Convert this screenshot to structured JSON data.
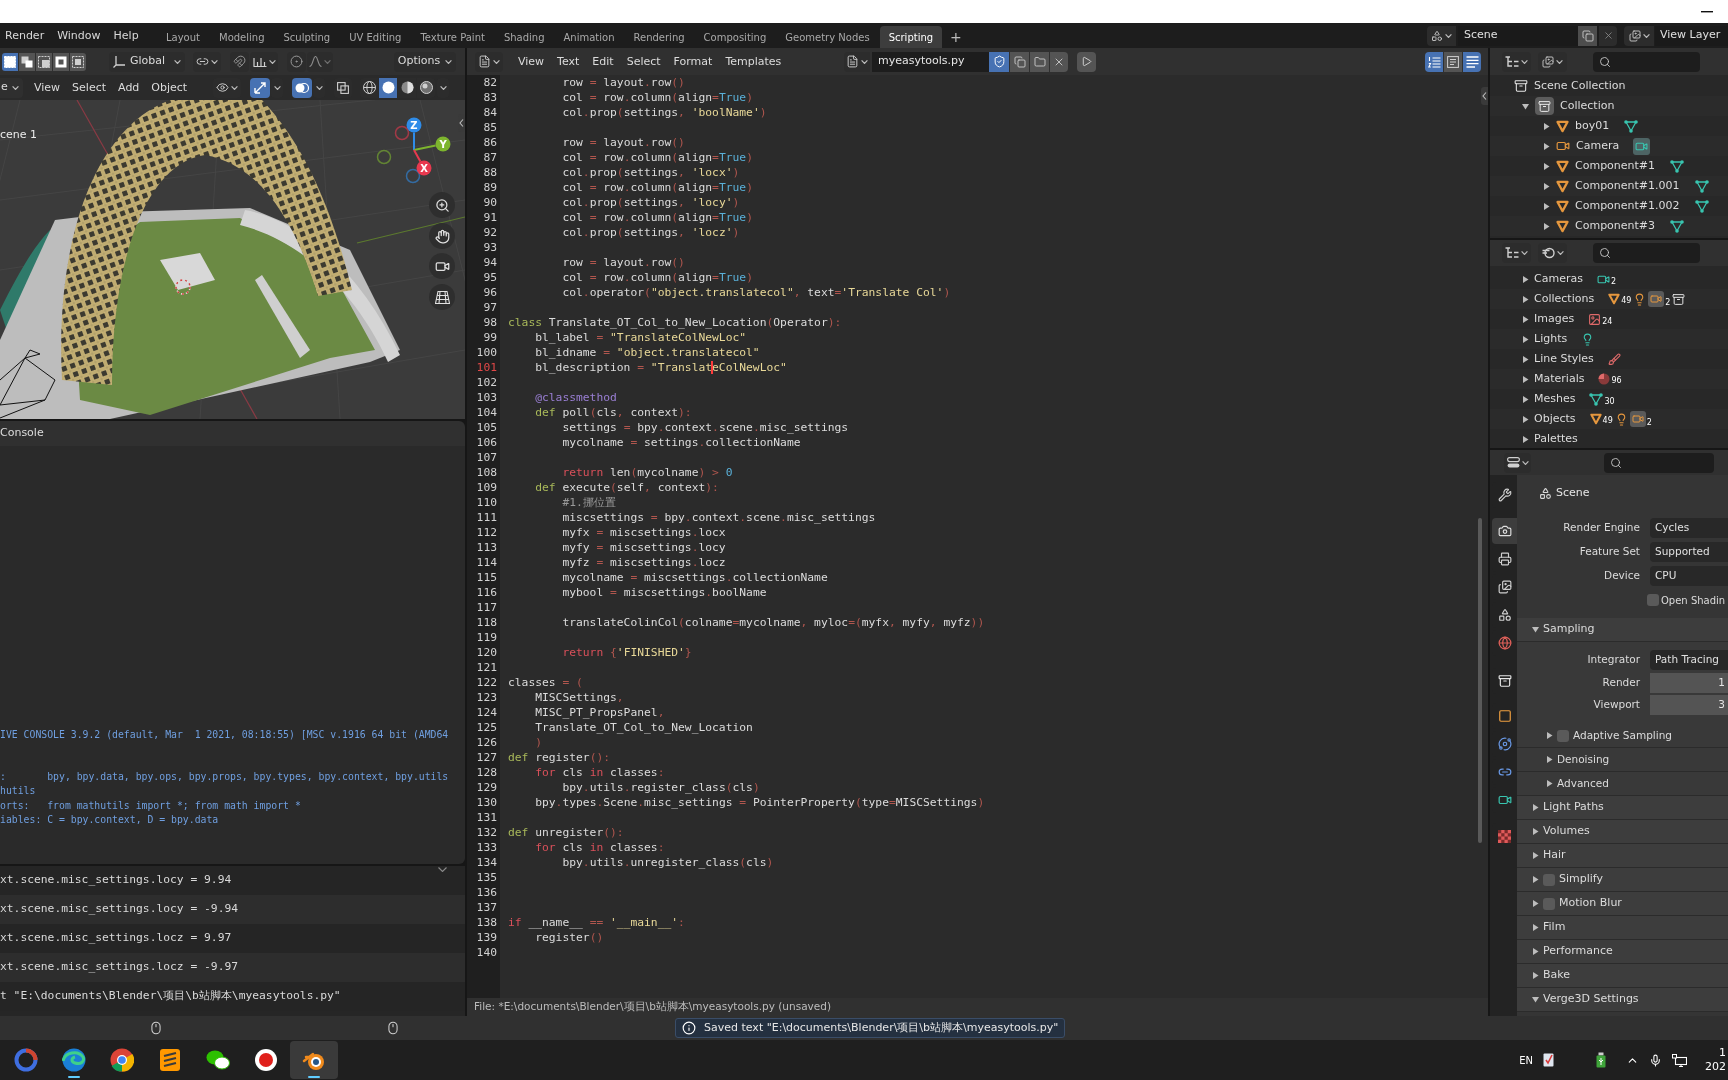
{
  "top_bar": {
    "menus": [
      "Render",
      "Window",
      "Help"
    ],
    "workspaces": [
      {
        "label": "Layout",
        "selected": false
      },
      {
        "label": "Modeling",
        "selected": false
      },
      {
        "label": "Sculpting",
        "selected": false
      },
      {
        "label": "UV Editing",
        "selected": false
      },
      {
        "label": "Texture Paint",
        "selected": false
      },
      {
        "label": "Shading",
        "selected": false
      },
      {
        "label": "Animation",
        "selected": false
      },
      {
        "label": "Rendering",
        "selected": false
      },
      {
        "label": "Compositing",
        "selected": false
      },
      {
        "label": "Geometry Nodes",
        "selected": false
      },
      {
        "label": "Scripting",
        "selected": true
      }
    ],
    "add_workspace": "+",
    "scene": "Scene",
    "view_layer": "View Layer"
  },
  "viewport": {
    "orientation": "Global",
    "options": "Options",
    "select_modes": [
      {
        "selected": true
      },
      {
        "selected": false
      },
      {
        "selected": false
      },
      {
        "selected": false
      },
      {
        "selected": false
      }
    ],
    "mode": "e",
    "menus": [
      "View",
      "Select",
      "Add",
      "Object"
    ],
    "gizmos": true,
    "overlays": true,
    "xray": false,
    "shading_modes": [
      {
        "kind": "wireframe",
        "selected": false
      },
      {
        "kind": "solid",
        "selected": true
      },
      {
        "kind": "material",
        "selected": false
      },
      {
        "kind": "rendered",
        "selected": false
      }
    ],
    "scene_label": "cene 1",
    "axes": [
      {
        "label": "Z",
        "color": "#2f8ce8"
      },
      {
        "label": "Y",
        "color": "#7db52e"
      },
      {
        "label": "X",
        "color": "#e8394f"
      }
    ]
  },
  "console": {
    "title": "Console",
    "blocks": [
      [
        "IVE CONSOLE 3.9.2 (default, Mar  1 2021, 08:18:55) [MSC v.1916 64 bit (AMD64"
      ],
      [
        ":       bpy, bpy.data, bpy.ops, bpy.props, bpy.types, bpy.context, bpy.utils",
        "hutils",
        "orts:   from mathutils import *; from math import *",
        "iables: C = bpy.context, D = bpy.data"
      ]
    ]
  },
  "info": {
    "reports": [
      "xt.scene.misc_settings.locy = 9.94",
      "xt.scene.misc_settings.locy = -9.94",
      "xt.scene.misc_settings.locz = 9.97",
      "xt.scene.misc_settings.locz = -9.97",
      "t \"E:\\documents\\Blender\\项目\\b站脚本\\myeasytools.py\""
    ]
  },
  "text_editor": {
    "menus": [
      "View",
      "Text",
      "Edit",
      "Select",
      "Format",
      "Templates"
    ],
    "file_name": "myeasytools.py",
    "fake_user": true,
    "line_numbers": true,
    "word_wrap": false,
    "syntax_highlight": true,
    "lines": [
      {
        "number": "82",
        "current": false,
        "segments": [
          {
            "kind": "plain",
            "text": "        row "
          },
          {
            "kind": "symbol",
            "text": "= "
          },
          {
            "kind": "plain",
            "text": "layout"
          },
          {
            "kind": "symbol",
            "text": "."
          },
          {
            "kind": "plain",
            "text": "row"
          },
          {
            "kind": "symbol",
            "text": "()"
          }
        ]
      },
      {
        "number": "83",
        "current": false,
        "segments": [
          {
            "kind": "plain",
            "text": "        col "
          },
          {
            "kind": "symbol",
            "text": "= "
          },
          {
            "kind": "plain",
            "text": "row"
          },
          {
            "kind": "symbol",
            "text": "."
          },
          {
            "kind": "plain",
            "text": "column"
          },
          {
            "kind": "symbol",
            "text": "("
          },
          {
            "kind": "plain",
            "text": "align"
          },
          {
            "kind": "symbol",
            "text": "="
          },
          {
            "kind": "bool",
            "text": "True"
          },
          {
            "kind": "symbol",
            "text": ")"
          }
        ]
      },
      {
        "number": "84",
        "current": false,
        "segments": [
          {
            "kind": "plain",
            "text": "        col"
          },
          {
            "kind": "symbol",
            "text": "."
          },
          {
            "kind": "plain",
            "text": "prop"
          },
          {
            "kind": "symbol",
            "text": "("
          },
          {
            "kind": "plain",
            "text": "settings"
          },
          {
            "kind": "symbol",
            "text": ", "
          },
          {
            "kind": "string",
            "text": "'boolName'"
          },
          {
            "kind": "symbol",
            "text": ")"
          }
        ]
      },
      {
        "number": "85",
        "current": false
      },
      {
        "number": "86",
        "current": false,
        "segments": [
          {
            "kind": "plain",
            "text": "        row "
          },
          {
            "kind": "symbol",
            "text": "= "
          },
          {
            "kind": "plain",
            "text": "layout"
          },
          {
            "kind": "symbol",
            "text": "."
          },
          {
            "kind": "plain",
            "text": "row"
          },
          {
            "kind": "symbol",
            "text": "()"
          }
        ]
      },
      {
        "number": "87",
        "current": false,
        "segments": [
          {
            "kind": "plain",
            "text": "        col "
          },
          {
            "kind": "symbol",
            "text": "= "
          },
          {
            "kind": "plain",
            "text": "row"
          },
          {
            "kind": "symbol",
            "text": "."
          },
          {
            "kind": "plain",
            "text": "column"
          },
          {
            "kind": "symbol",
            "text": "("
          },
          {
            "kind": "plain",
            "text": "align"
          },
          {
            "kind": "symbol",
            "text": "="
          },
          {
            "kind": "bool",
            "text": "True"
          },
          {
            "kind": "symbol",
            "text": ")"
          }
        ]
      },
      {
        "number": "88",
        "current": false,
        "segments": [
          {
            "kind": "plain",
            "text": "        col"
          },
          {
            "kind": "symbol",
            "text": "."
          },
          {
            "kind": "plain",
            "text": "prop"
          },
          {
            "kind": "symbol",
            "text": "("
          },
          {
            "kind": "plain",
            "text": "settings"
          },
          {
            "kind": "symbol",
            "text": ", "
          },
          {
            "kind": "string",
            "text": "'locx'"
          },
          {
            "kind": "symbol",
            "text": ")"
          }
        ]
      },
      {
        "number": "89",
        "current": false,
        "segments": [
          {
            "kind": "plain",
            "text": "        col "
          },
          {
            "kind": "symbol",
            "text": "= "
          },
          {
            "kind": "plain",
            "text": "row"
          },
          {
            "kind": "symbol",
            "text": "."
          },
          {
            "kind": "plain",
            "text": "column"
          },
          {
            "kind": "symbol",
            "text": "("
          },
          {
            "kind": "plain",
            "text": "align"
          },
          {
            "kind": "symbol",
            "text": "="
          },
          {
            "kind": "bool",
            "text": "True"
          },
          {
            "kind": "symbol",
            "text": ")"
          }
        ]
      },
      {
        "number": "90",
        "current": false,
        "segments": [
          {
            "kind": "plain",
            "text": "        col"
          },
          {
            "kind": "symbol",
            "text": "."
          },
          {
            "kind": "plain",
            "text": "prop"
          },
          {
            "kind": "symbol",
            "text": "("
          },
          {
            "kind": "plain",
            "text": "settings"
          },
          {
            "kind": "symbol",
            "text": ", "
          },
          {
            "kind": "string",
            "text": "'locy'"
          },
          {
            "kind": "symbol",
            "text": ")"
          }
        ]
      },
      {
        "number": "91",
        "current": false,
        "segments": [
          {
            "kind": "plain",
            "text": "        col "
          },
          {
            "kind": "symbol",
            "text": "= "
          },
          {
            "kind": "plain",
            "text": "row"
          },
          {
            "kind": "symbol",
            "text": "."
          },
          {
            "kind": "plain",
            "text": "column"
          },
          {
            "kind": "symbol",
            "text": "("
          },
          {
            "kind": "plain",
            "text": "align"
          },
          {
            "kind": "symbol",
            "text": "="
          },
          {
            "kind": "bool",
            "text": "True"
          },
          {
            "kind": "symbol",
            "text": ")"
          }
        ]
      },
      {
        "number": "92",
        "current": false,
        "segments": [
          {
            "kind": "plain",
            "text": "        col"
          },
          {
            "kind": "symbol",
            "text": "."
          },
          {
            "kind": "plain",
            "text": "prop"
          },
          {
            "kind": "symbol",
            "text": "("
          },
          {
            "kind": "plain",
            "text": "settings"
          },
          {
            "kind": "symbol",
            "text": ", "
          },
          {
            "kind": "string",
            "text": "'locz'"
          },
          {
            "kind": "symbol",
            "text": ")"
          }
        ]
      },
      {
        "number": "93",
        "current": false
      },
      {
        "number": "94",
        "current": false,
        "segments": [
          {
            "kind": "plain",
            "text": "        row "
          },
          {
            "kind": "symbol",
            "text": "= "
          },
          {
            "kind": "plain",
            "text": "layout"
          },
          {
            "kind": "symbol",
            "text": "."
          },
          {
            "kind": "plain",
            "text": "row"
          },
          {
            "kind": "symbol",
            "text": "()"
          }
        ]
      },
      {
        "number": "95",
        "current": false,
        "segments": [
          {
            "kind": "plain",
            "text": "        col "
          },
          {
            "kind": "symbol",
            "text": "= "
          },
          {
            "kind": "plain",
            "text": "row"
          },
          {
            "kind": "symbol",
            "text": "."
          },
          {
            "kind": "plain",
            "text": "column"
          },
          {
            "kind": "symbol",
            "text": "("
          },
          {
            "kind": "plain",
            "text": "align"
          },
          {
            "kind": "symbol",
            "text": "="
          },
          {
            "kind": "bool",
            "text": "True"
          },
          {
            "kind": "symbol",
            "text": ")"
          }
        ]
      },
      {
        "number": "96",
        "current": false,
        "segments": [
          {
            "kind": "plain",
            "text": "        col"
          },
          {
            "kind": "symbol",
            "text": "."
          },
          {
            "kind": "plain",
            "text": "operator"
          },
          {
            "kind": "symbol",
            "text": "("
          },
          {
            "kind": "string",
            "text": "\"object.translatecol\""
          },
          {
            "kind": "symbol",
            "text": ", "
          },
          {
            "kind": "plain",
            "text": "text"
          },
          {
            "kind": "symbol",
            "text": "="
          },
          {
            "kind": "string",
            "text": "'Translate Col'"
          },
          {
            "kind": "symbol",
            "text": ")"
          }
        ]
      },
      {
        "number": "97",
        "current": false
      },
      {
        "number": "98",
        "current": false,
        "segments": [
          {
            "kind": "special",
            "text": "class"
          },
          {
            "kind": "plain",
            "text": " Translate_OT_Col_to_New_Location"
          },
          {
            "kind": "symbol",
            "text": "("
          },
          {
            "kind": "plain",
            "text": "Operator"
          },
          {
            "kind": "symbol",
            "text": "):"
          }
        ]
      },
      {
        "number": "99",
        "current": false,
        "segments": [
          {
            "kind": "plain",
            "text": "    bl_label "
          },
          {
            "kind": "symbol",
            "text": "= "
          },
          {
            "kind": "string",
            "text": "\"TranslateColNewLoc\""
          }
        ]
      },
      {
        "number": "100",
        "current": false,
        "segments": [
          {
            "kind": "plain",
            "text": "    bl_idname "
          },
          {
            "kind": "symbol",
            "text": "= "
          },
          {
            "kind": "string",
            "text": "\"object.translatecol\""
          }
        ]
      },
      {
        "number": "101",
        "current": true,
        "segments": [
          {
            "kind": "plain",
            "text": "    bl_description ",
            "caret": false
          },
          {
            "kind": "symbol",
            "text": "= ",
            "caret": false
          },
          {
            "kind": "string",
            "text": "\"Translat",
            "caret": false
          },
          {
            "kind": "string",
            "text": "eColNewLoc\"",
            "caret": true
          }
        ]
      },
      {
        "number": "102",
        "current": false
      },
      {
        "number": "103",
        "current": false,
        "segments": [
          {
            "kind": "decorator",
            "text": "    @classmethod"
          }
        ]
      },
      {
        "number": "104",
        "current": false,
        "segments": [
          {
            "kind": "special",
            "text": "    def"
          },
          {
            "kind": "plain",
            "text": " poll"
          },
          {
            "kind": "symbol",
            "text": "("
          },
          {
            "kind": "plain",
            "text": "cls"
          },
          {
            "kind": "symbol",
            "text": ", "
          },
          {
            "kind": "plain",
            "text": "context"
          },
          {
            "kind": "symbol",
            "text": "):"
          }
        ]
      },
      {
        "number": "105",
        "current": false,
        "segments": [
          {
            "kind": "plain",
            "text": "        settings "
          },
          {
            "kind": "symbol",
            "text": "= "
          },
          {
            "kind": "plain",
            "text": "bpy"
          },
          {
            "kind": "symbol",
            "text": "."
          },
          {
            "kind": "plain",
            "text": "context"
          },
          {
            "kind": "symbol",
            "text": "."
          },
          {
            "kind": "plain",
            "text": "scene"
          },
          {
            "kind": "symbol",
            "text": "."
          },
          {
            "kind": "plain",
            "text": "misc_settings"
          }
        ]
      },
      {
        "number": "106",
        "current": false,
        "segments": [
          {
            "kind": "plain",
            "text": "        mycolname "
          },
          {
            "kind": "symbol",
            "text": "= "
          },
          {
            "kind": "plain",
            "text": "settings"
          },
          {
            "kind": "symbol",
            "text": "."
          },
          {
            "kind": "plain",
            "text": "collectionName"
          }
        ]
      },
      {
        "number": "107",
        "current": false
      },
      {
        "number": "108",
        "current": false,
        "segments": [
          {
            "kind": "keyword",
            "text": "        return"
          },
          {
            "kind": "plain",
            "text": " len"
          },
          {
            "kind": "symbol",
            "text": "("
          },
          {
            "kind": "plain",
            "text": "mycolname"
          },
          {
            "kind": "symbol",
            "text": ") > "
          },
          {
            "kind": "number",
            "text": "0"
          }
        ]
      },
      {
        "number": "109",
        "current": false,
        "segments": [
          {
            "kind": "special",
            "text": "    def"
          },
          {
            "kind": "plain",
            "text": " execute"
          },
          {
            "kind": "symbol",
            "text": "("
          },
          {
            "kind": "plain",
            "text": "self"
          },
          {
            "kind": "symbol",
            "text": ", "
          },
          {
            "kind": "plain",
            "text": "context"
          },
          {
            "kind": "symbol",
            "text": "):"
          }
        ]
      },
      {
        "number": "110",
        "current": false,
        "segments": [
          {
            "kind": "comment",
            "text": "        #1.挪位置"
          }
        ]
      },
      {
        "number": "111",
        "current": false,
        "segments": [
          {
            "kind": "plain",
            "text": "        miscsettings "
          },
          {
            "kind": "symbol",
            "text": "= "
          },
          {
            "kind": "plain",
            "text": "bpy"
          },
          {
            "kind": "symbol",
            "text": "."
          },
          {
            "kind": "plain",
            "text": "context"
          },
          {
            "kind": "symbol",
            "text": "."
          },
          {
            "kind": "plain",
            "text": "scene"
          },
          {
            "kind": "symbol",
            "text": "."
          },
          {
            "kind": "plain",
            "text": "misc_settings"
          }
        ]
      },
      {
        "number": "112",
        "current": false,
        "segments": [
          {
            "kind": "plain",
            "text": "        myfx "
          },
          {
            "kind": "symbol",
            "text": "= "
          },
          {
            "kind": "plain",
            "text": "miscsettings"
          },
          {
            "kind": "symbol",
            "text": "."
          },
          {
            "kind": "plain",
            "text": "locx"
          }
        ]
      },
      {
        "number": "113",
        "current": false,
        "segments": [
          {
            "kind": "plain",
            "text": "        myfy "
          },
          {
            "kind": "symbol",
            "text": "= "
          },
          {
            "kind": "plain",
            "text": "miscsettings"
          },
          {
            "kind": "symbol",
            "text": "."
          },
          {
            "kind": "plain",
            "text": "locy"
          }
        ]
      },
      {
        "number": "114",
        "current": false,
        "segments": [
          {
            "kind": "plain",
            "text": "        myfz "
          },
          {
            "kind": "symbol",
            "text": "= "
          },
          {
            "kind": "plain",
            "text": "miscsettings"
          },
          {
            "kind": "symbol",
            "text": "."
          },
          {
            "kind": "plain",
            "text": "locz"
          }
        ]
      },
      {
        "number": "115",
        "current": false,
        "segments": [
          {
            "kind": "plain",
            "text": "        mycolname "
          },
          {
            "kind": "symbol",
            "text": "= "
          },
          {
            "kind": "plain",
            "text": "miscsettings"
          },
          {
            "kind": "symbol",
            "text": "."
          },
          {
            "kind": "plain",
            "text": "collectionName"
          }
        ]
      },
      {
        "number": "116",
        "current": false,
        "segments": [
          {
            "kind": "plain",
            "text": "        mybool "
          },
          {
            "kind": "symbol",
            "text": "= "
          },
          {
            "kind": "plain",
            "text": "miscsettings"
          },
          {
            "kind": "symbol",
            "text": "."
          },
          {
            "kind": "plain",
            "text": "boolName"
          }
        ]
      },
      {
        "number": "117",
        "current": false
      },
      {
        "number": "118",
        "current": false,
        "segments": [
          {
            "kind": "plain",
            "text": "        translateColinCol"
          },
          {
            "kind": "symbol",
            "text": "("
          },
          {
            "kind": "plain",
            "text": "colname"
          },
          {
            "kind": "symbol",
            "text": "="
          },
          {
            "kind": "plain",
            "text": "mycolname"
          },
          {
            "kind": "symbol",
            "text": ", "
          },
          {
            "kind": "plain",
            "text": "myloc"
          },
          {
            "kind": "symbol",
            "text": "=("
          },
          {
            "kind": "plain",
            "text": "myfx"
          },
          {
            "kind": "symbol",
            "text": ", "
          },
          {
            "kind": "plain",
            "text": "myfy"
          },
          {
            "kind": "symbol",
            "text": ", "
          },
          {
            "kind": "plain",
            "text": "myfz"
          },
          {
            "kind": "symbol",
            "text": "))"
          }
        ]
      },
      {
        "number": "119",
        "current": false
      },
      {
        "number": "120",
        "current": false,
        "segments": [
          {
            "kind": "keyword",
            "text": "        return"
          },
          {
            "kind": "symbol",
            "text": " {"
          },
          {
            "kind": "string",
            "text": "'FINISHED'"
          },
          {
            "kind": "symbol",
            "text": "}"
          }
        ]
      },
      {
        "number": "121",
        "current": false
      },
      {
        "number": "122",
        "current": false,
        "segments": [
          {
            "kind": "plain",
            "text": "classes "
          },
          {
            "kind": "symbol",
            "text": "= ("
          }
        ]
      },
      {
        "number": "123",
        "current": false,
        "segments": [
          {
            "kind": "plain",
            "text": "    MISCSettings"
          },
          {
            "kind": "symbol",
            "text": ","
          }
        ]
      },
      {
        "number": "124",
        "current": false,
        "segments": [
          {
            "kind": "plain",
            "text": "    MISC_PT_PropsPanel"
          },
          {
            "kind": "symbol",
            "text": ","
          }
        ]
      },
      {
        "number": "125",
        "current": false,
        "segments": [
          {
            "kind": "plain",
            "text": "    Translate_OT_Col_to_New_Location"
          }
        ]
      },
      {
        "number": "126",
        "current": false,
        "segments": [
          {
            "kind": "symbol",
            "text": "    )"
          }
        ]
      },
      {
        "number": "127",
        "current": false,
        "segments": [
          {
            "kind": "special",
            "text": "def"
          },
          {
            "kind": "plain",
            "text": " register"
          },
          {
            "kind": "symbol",
            "text": "():"
          }
        ]
      },
      {
        "number": "128",
        "current": false,
        "segments": [
          {
            "kind": "keyword",
            "text": "    for"
          },
          {
            "kind": "plain",
            "text": " cls "
          },
          {
            "kind": "keyword",
            "text": "in"
          },
          {
            "kind": "plain",
            "text": " classes"
          },
          {
            "kind": "symbol",
            "text": ":"
          }
        ]
      },
      {
        "number": "129",
        "current": false,
        "segments": [
          {
            "kind": "plain",
            "text": "        bpy"
          },
          {
            "kind": "symbol",
            "text": "."
          },
          {
            "kind": "plain",
            "text": "utils"
          },
          {
            "kind": "symbol",
            "text": "."
          },
          {
            "kind": "plain",
            "text": "register_class"
          },
          {
            "kind": "symbol",
            "text": "("
          },
          {
            "kind": "plain",
            "text": "cls"
          },
          {
            "kind": "symbol",
            "text": ")"
          }
        ]
      },
      {
        "number": "130",
        "current": false,
        "segments": [
          {
            "kind": "plain",
            "text": "    bpy"
          },
          {
            "kind": "symbol",
            "text": "."
          },
          {
            "kind": "plain",
            "text": "types"
          },
          {
            "kind": "symbol",
            "text": "."
          },
          {
            "kind": "plain",
            "text": "Scene"
          },
          {
            "kind": "symbol",
            "text": "."
          },
          {
            "kind": "plain",
            "text": "misc_settings "
          },
          {
            "kind": "symbol",
            "text": "= "
          },
          {
            "kind": "plain",
            "text": "PointerProperty"
          },
          {
            "kind": "symbol",
            "text": "("
          },
          {
            "kind": "plain",
            "text": "type"
          },
          {
            "kind": "symbol",
            "text": "="
          },
          {
            "kind": "plain",
            "text": "MISCSettings"
          },
          {
            "kind": "symbol",
            "text": ")"
          }
        ]
      },
      {
        "number": "131",
        "current": false
      },
      {
        "number": "132",
        "current": false,
        "segments": [
          {
            "kind": "special",
            "text": "def"
          },
          {
            "kind": "plain",
            "text": " unregister"
          },
          {
            "kind": "symbol",
            "text": "():"
          }
        ]
      },
      {
        "number": "133",
        "current": false,
        "segments": [
          {
            "kind": "keyword",
            "text": "    for"
          },
          {
            "kind": "plain",
            "text": " cls "
          },
          {
            "kind": "keyword",
            "text": "in"
          },
          {
            "kind": "plain",
            "text": " classes"
          },
          {
            "kind": "symbol",
            "text": ":"
          }
        ]
      },
      {
        "number": "134",
        "current": false,
        "segments": [
          {
            "kind": "plain",
            "text": "        bpy"
          },
          {
            "kind": "symbol",
            "text": "."
          },
          {
            "kind": "plain",
            "text": "utils"
          },
          {
            "kind": "symbol",
            "text": "."
          },
          {
            "kind": "plain",
            "text": "unregister_class"
          },
          {
            "kind": "symbol",
            "text": "("
          },
          {
            "kind": "plain",
            "text": "cls"
          },
          {
            "kind": "symbol",
            "text": ")"
          }
        ]
      },
      {
        "number": "135",
        "current": false
      },
      {
        "number": "136",
        "current": false
      },
      {
        "number": "137",
        "current": false
      },
      {
        "number": "138",
        "current": false,
        "segments": [
          {
            "kind": "keyword",
            "text": "if"
          },
          {
            "kind": "plain",
            "text": " __name__ "
          },
          {
            "kind": "symbol",
            "text": "== "
          },
          {
            "kind": "string",
            "text": "'__main__'"
          },
          {
            "kind": "symbol",
            "text": ":"
          }
        ]
      },
      {
        "number": "139",
        "current": false,
        "segments": [
          {
            "kind": "plain",
            "text": "    register"
          },
          {
            "kind": "symbol",
            "text": "()"
          }
        ]
      },
      {
        "number": "140",
        "current": false
      }
    ],
    "status": "File: *E:\\documents\\Blender\\项目\\b站脚本\\myeasytools.py (unsaved)"
  },
  "outliner": {
    "tree": [
      {
        "label": "Scene Collection",
        "kind": "scene_collection",
        "children": [
          {
            "label": "Collection",
            "kind": "collection",
            "expanded": true,
            "children": [
              {
                "label": "boy01",
                "kind": "mesh",
                "expanded": false,
                "active_data": false
              },
              {
                "label": "Camera",
                "kind": "camera",
                "expanded": false,
                "active_data": true
              },
              {
                "label": "Component#1",
                "kind": "mesh",
                "expanded": false,
                "active_data": false
              },
              {
                "label": "Component#1.001",
                "kind": "mesh",
                "expanded": false,
                "active_data": false
              },
              {
                "label": "Component#1.002",
                "kind": "mesh",
                "expanded": false,
                "active_data": false
              },
              {
                "label": "Component#3",
                "kind": "mesh",
                "expanded": false,
                "active_data": false
              }
            ]
          }
        ]
      }
    ]
  },
  "blender_file": {
    "items": [
      {
        "label": "Cameras",
        "expanded": false,
        "badges": [
          {
            "kind": "camera_data",
            "count": "2"
          }
        ]
      },
      {
        "label": "Collections",
        "expanded": false,
        "badges": [
          {
            "kind": "mesh_object",
            "count": "49"
          },
          {
            "kind": "light"
          },
          {
            "kind": "camera_object",
            "count": "2"
          },
          {
            "kind": "collection"
          }
        ]
      },
      {
        "label": "Images",
        "expanded": false,
        "badges": [
          {
            "kind": "image",
            "count": "24"
          }
        ]
      },
      {
        "label": "Lights",
        "expanded": false,
        "badges": [
          {
            "kind": "light_data"
          }
        ]
      },
      {
        "label": "Line Styles",
        "expanded": false,
        "badges": [
          {
            "kind": "line_style"
          }
        ]
      },
      {
        "label": "Materials",
        "expanded": false,
        "badges": [
          {
            "kind": "material",
            "count": "96"
          }
        ]
      },
      {
        "label": "Meshes",
        "expanded": false,
        "badges": [
          {
            "kind": "mesh_data",
            "count": "30"
          }
        ]
      },
      {
        "label": "Objects",
        "expanded": false,
        "badges": [
          {
            "kind": "mesh_object",
            "count": "49"
          },
          {
            "kind": "light"
          },
          {
            "kind": "camera_object",
            "count": "2"
          }
        ]
      },
      {
        "label": "Palettes",
        "expanded": false
      }
    ]
  },
  "properties": {
    "tab_groups": [
      [
        {
          "kind": "tool",
          "selected": false
        }
      ],
      [
        {
          "kind": "render",
          "selected": true
        },
        {
          "kind": "output",
          "selected": false
        },
        {
          "kind": "view_layer",
          "selected": false
        },
        {
          "kind": "scene",
          "selected": false
        },
        {
          "kind": "world",
          "selected": false
        }
      ],
      [
        {
          "kind": "collection",
          "selected": false
        }
      ],
      [
        {
          "kind": "object",
          "selected": false
        },
        {
          "kind": "physics",
          "selected": false
        },
        {
          "kind": "constraints",
          "selected": false
        },
        {
          "kind": "data",
          "selected": false
        }
      ],
      [
        {
          "kind": "texture",
          "selected": false
        }
      ]
    ],
    "context": "Scene",
    "fields": [
      {
        "kind": "dropdown",
        "label": "Render Engine",
        "value": "Cycles"
      },
      {
        "kind": "dropdown",
        "label": "Feature Set",
        "value": "Supported"
      },
      {
        "kind": "dropdown",
        "label": "Device",
        "value": "CPU"
      },
      {
        "kind": "checkbox",
        "label": "Open Shadin",
        "checked": false
      }
    ],
    "panels": [
      {
        "label": "Sampling",
        "expanded": true,
        "rows": [
          {
            "kind": "dropdown",
            "label": "Integrator",
            "value": "Path Tracing"
          },
          {
            "kind": "number",
            "label": "Render",
            "value": "1"
          },
          {
            "kind": "number",
            "label": "Viewport",
            "value": "3"
          }
        ],
        "children": [
          {
            "label": "Adaptive Sampling",
            "expanded": false,
            "checked": false
          },
          {
            "label": "Denoising",
            "expanded": false
          },
          {
            "label": "Advanced",
            "expanded": false
          }
        ]
      },
      {
        "label": "Light Paths",
        "expanded": false
      },
      {
        "label": "Volumes",
        "expanded": false
      },
      {
        "label": "Hair",
        "expanded": false
      },
      {
        "label": "Simplify",
        "expanded": false,
        "checked": false
      },
      {
        "label": "Motion Blur",
        "expanded": false,
        "checked": false
      },
      {
        "label": "Film",
        "expanded": false
      },
      {
        "label": "Performance",
        "expanded": false
      },
      {
        "label": "Bake",
        "expanded": false
      },
      {
        "label": "Verge3D Settings",
        "expanded": true
      }
    ]
  },
  "status_bar": {
    "message": "Saved text \"E:\\documents\\Blender\\项目\\b站脚本\\myeasytools.py\""
  },
  "taskbar": {
    "apps": [
      {
        "kind": "ring",
        "running": false,
        "active": false
      },
      {
        "kind": "swirl",
        "running": true,
        "active": false
      },
      {
        "kind": "wheel",
        "running": false,
        "active": false
      },
      {
        "kind": "tile",
        "running": false,
        "active": false
      },
      {
        "kind": "chat",
        "running": false,
        "active": false
      },
      {
        "kind": "record",
        "running": false,
        "active": false
      },
      {
        "kind": "logo",
        "running": true,
        "active": true
      }
    ],
    "language": "EN",
    "clock": {
      "time": "1",
      "date": "202"
    }
  }
}
